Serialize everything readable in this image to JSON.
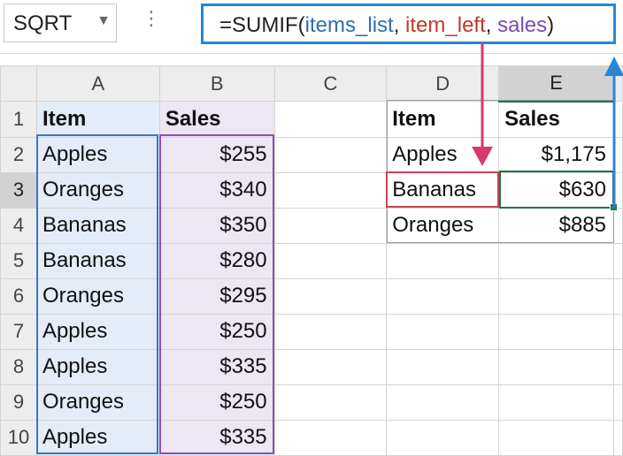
{
  "formula_bar": {
    "name_box": "SQRT",
    "dots": "⋮",
    "formula": {
      "prefix": "=SUMIF(",
      "arg1": "items_list",
      "sep1": ", ",
      "arg2": "item_left",
      "sep2": ", ",
      "arg3": "sales",
      "suffix": ")"
    }
  },
  "columns": [
    "A",
    "B",
    "C",
    "D",
    "E"
  ],
  "rows": [
    "1",
    "2",
    "3",
    "4",
    "5",
    "6",
    "7",
    "8",
    "9",
    "10"
  ],
  "cells": {
    "A": [
      "Item",
      "Apples",
      "Oranges",
      "Bananas",
      "Bananas",
      "Oranges",
      "Apples",
      "Apples",
      "Oranges",
      "Apples"
    ],
    "B": [
      "Sales",
      "$255",
      "$340",
      "$350",
      "$280",
      "$295",
      "$250",
      "$335",
      "$250",
      "$335"
    ],
    "D": [
      "Item",
      "Apples",
      "Bananas",
      "Oranges"
    ],
    "E": [
      "Sales",
      "$1,175",
      "$630",
      "$885"
    ]
  },
  "colors": {
    "items_list": "#2e6db4",
    "item_left": "#c0392b",
    "sales": "#7b4bb0",
    "formula_box": "#2a86d4",
    "active_cell": "#217346",
    "arrow_pink": "#d63a6a"
  },
  "icons": {
    "name_box_dropdown": "dropdown-arrow-icon",
    "formula_options": "vertical-dots-icon"
  }
}
